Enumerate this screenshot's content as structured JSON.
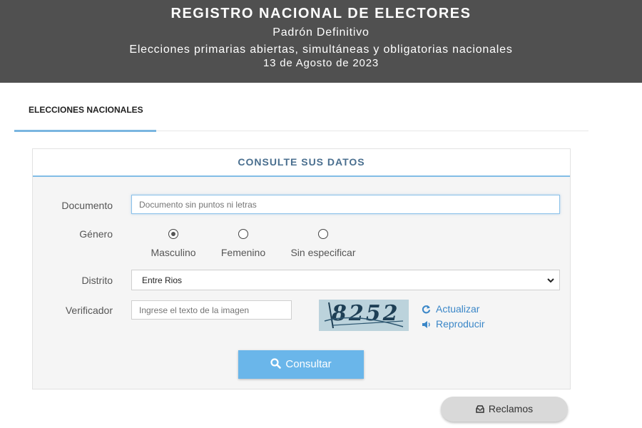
{
  "header": {
    "title": "REGISTRO NACIONAL DE ELECTORES",
    "subtitle": "Padrón Definitivo",
    "description": "Elecciones primarias abiertas, simultáneas y obligatorias nacionales",
    "date": "13 de Agosto de 2023"
  },
  "tabs": [
    {
      "label": "ELECCIONES NACIONALES",
      "active": true
    }
  ],
  "panel": {
    "title": "CONSULTE SUS DATOS"
  },
  "form": {
    "documento": {
      "label": "Documento",
      "placeholder": "Documento sin puntos ni letras",
      "value": ""
    },
    "genero": {
      "label": "Género",
      "options": [
        {
          "label": "Masculino",
          "selected": true
        },
        {
          "label": "Femenino",
          "selected": false
        },
        {
          "label": "Sin especificar",
          "selected": false
        }
      ]
    },
    "distrito": {
      "label": "Distrito",
      "selected": "Entre Rios"
    },
    "verificador": {
      "label": "Verificador",
      "placeholder": "Ingrese el texto de la imagen",
      "captcha_text": "8252",
      "refresh_label": "Actualizar",
      "play_label": "Reproducir"
    },
    "submit_label": "Consultar"
  },
  "reclamos_label": "Reclamos",
  "colors": {
    "header_bg": "#505050",
    "accent": "#6ab6ea",
    "link": "#3b87c8",
    "panel_title": "#4a6f8f"
  },
  "icons": {
    "submit": "search-icon",
    "refresh": "refresh-icon",
    "play": "speaker-icon",
    "reclamos": "inbox-icon",
    "select": "chevron-down-icon"
  }
}
